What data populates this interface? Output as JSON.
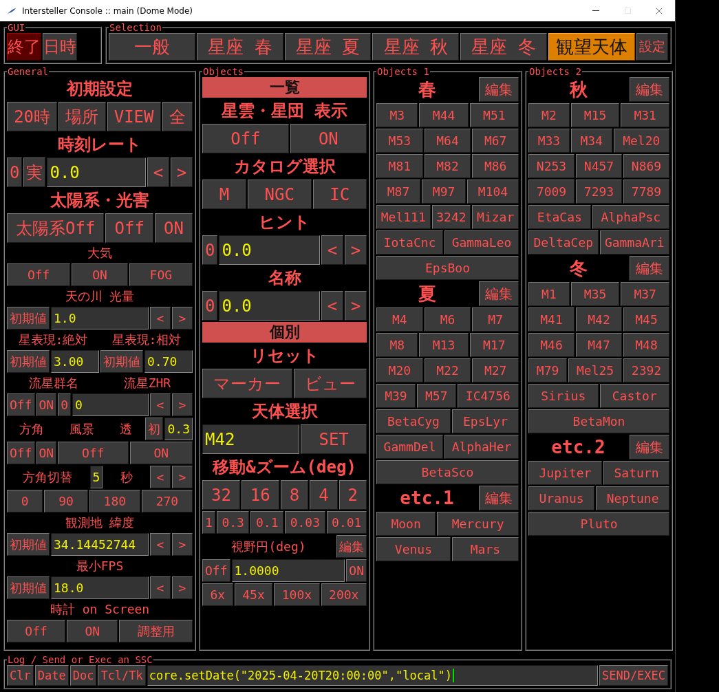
{
  "window": {
    "title": "Intersteller Console :: main (Dome Mode)"
  },
  "gui": {
    "title": "GUI",
    "buttons": [
      {
        "label": "終了",
        "selected": true
      },
      {
        "label": "日時",
        "selected": false
      }
    ]
  },
  "selection": {
    "title": "Selection",
    "tabs": [
      {
        "label": "一般",
        "selected": false,
        "kind": "tab"
      },
      {
        "label": "星座 春",
        "selected": false,
        "kind": "tab"
      },
      {
        "label": "星座 夏",
        "selected": false,
        "kind": "tab"
      },
      {
        "label": "星座 秋",
        "selected": false,
        "kind": "tab"
      },
      {
        "label": "星座 冬",
        "selected": false,
        "kind": "tab"
      },
      {
        "label": "観望天体",
        "selected": true,
        "kind": "tab"
      },
      {
        "label": "設定",
        "selected": false,
        "kind": "small"
      }
    ]
  },
  "panels": [
    {
      "title": "General",
      "rows": [
        {
          "kind": "heading",
          "items": [
            {
              "kind": "text",
              "label": "初期設定"
            }
          ]
        },
        {
          "kind": "large",
          "items": [
            {
              "kind": "button",
              "label": "20時"
            },
            {
              "kind": "button",
              "label": "場所"
            },
            {
              "kind": "button",
              "label": "VIEW"
            },
            {
              "kind": "button",
              "label": "全"
            }
          ]
        },
        {
          "kind": "heading",
          "items": [
            {
              "kind": "text",
              "label": "時刻レート"
            }
          ]
        },
        {
          "kind": "large",
          "items": [
            {
              "kind": "key",
              "label": "0"
            },
            {
              "kind": "key",
              "label": "実"
            },
            {
              "kind": "field",
              "label": "0.0"
            },
            {
              "kind": "step",
              "label": "<"
            },
            {
              "kind": "step",
              "label": ">"
            }
          ]
        },
        {
          "kind": "heading",
          "items": [
            {
              "kind": "text",
              "label": "太陽系・光害"
            }
          ]
        },
        {
          "kind": "large",
          "items": [
            {
              "kind": "button",
              "label": "太陽系Off"
            },
            {
              "kind": "button",
              "label": "Off"
            },
            {
              "kind": "button",
              "label": "ON"
            }
          ]
        },
        {
          "kind": "label",
          "items": [
            {
              "kind": "text",
              "label": "大気"
            }
          ]
        },
        {
          "kind": "small",
          "items": [
            {
              "kind": "button",
              "label": "Off"
            },
            {
              "kind": "button",
              "label": "ON"
            },
            {
              "kind": "button",
              "label": "FOG"
            }
          ]
        },
        {
          "kind": "label",
          "items": [
            {
              "kind": "text",
              "label": "天の川 光量"
            }
          ]
        },
        {
          "kind": "small",
          "items": [
            {
              "kind": "key",
              "label": "初期値"
            },
            {
              "kind": "field",
              "label": "1.0"
            },
            {
              "kind": "step",
              "label": "<"
            },
            {
              "kind": "step",
              "label": ">"
            }
          ]
        },
        {
          "kind": "label",
          "items": [
            {
              "kind": "text",
              "label": "星表現:絶対"
            },
            {
              "kind": "text",
              "label": "星表現:相対"
            }
          ]
        },
        {
          "kind": "small",
          "items": [
            {
              "kind": "key",
              "label": "初期値"
            },
            {
              "kind": "field",
              "label": "3.00"
            },
            {
              "kind": "key",
              "label": "初期値"
            },
            {
              "kind": "field",
              "label": "0.70"
            }
          ]
        },
        {
          "kind": "label",
          "items": [
            {
              "kind": "text",
              "label": "流星群名"
            },
            {
              "kind": "text",
              "label": "流星ZHR"
            }
          ]
        },
        {
          "kind": "small",
          "items": [
            {
              "kind": "key",
              "label": "Off"
            },
            {
              "kind": "key",
              "label": "ON"
            },
            {
              "kind": "key",
              "label": "0"
            },
            {
              "kind": "field",
              "label": "0"
            },
            {
              "kind": "step",
              "label": "<"
            },
            {
              "kind": "step",
              "label": ">"
            }
          ]
        },
        {
          "kind": "small",
          "items": [
            {
              "kind": "text",
              "label": "方角"
            },
            {
              "kind": "text",
              "label": "風景"
            },
            {
              "kind": "text",
              "label": "透"
            },
            {
              "kind": "key",
              "label": "初"
            },
            {
              "kind": "value",
              "label": "0.3"
            }
          ]
        },
        {
          "kind": "small",
          "items": [
            {
              "kind": "key",
              "label": "Off"
            },
            {
              "kind": "key",
              "label": "ON"
            },
            {
              "kind": "button",
              "label": "Off"
            },
            {
              "kind": "button",
              "label": "ON"
            }
          ]
        },
        {
          "kind": "small",
          "items": [
            {
              "kind": "text",
              "label": "方角切替"
            },
            {
              "kind": "value",
              "label": "5"
            },
            {
              "kind": "text",
              "label": "秒"
            },
            {
              "kind": "step",
              "label": "<"
            },
            {
              "kind": "step",
              "label": ">"
            }
          ]
        },
        {
          "kind": "small",
          "items": [
            {
              "kind": "button",
              "label": "0"
            },
            {
              "kind": "button",
              "label": "90"
            },
            {
              "kind": "button",
              "label": "180"
            },
            {
              "kind": "button",
              "label": "270"
            }
          ]
        },
        {
          "kind": "label",
          "items": [
            {
              "kind": "text",
              "label": "観測地 緯度"
            }
          ]
        },
        {
          "kind": "small",
          "items": [
            {
              "kind": "key",
              "label": "初期値"
            },
            {
              "kind": "field",
              "label": "34.14452744"
            },
            {
              "kind": "step",
              "label": "<"
            },
            {
              "kind": "step",
              "label": ">"
            }
          ]
        },
        {
          "kind": "label",
          "items": [
            {
              "kind": "text",
              "label": "最小FPS"
            }
          ]
        },
        {
          "kind": "small",
          "items": [
            {
              "kind": "key",
              "label": "初期値"
            },
            {
              "kind": "field",
              "label": "18.0"
            },
            {
              "kind": "step",
              "label": "<"
            },
            {
              "kind": "step",
              "label": ">"
            }
          ]
        },
        {
          "kind": "label",
          "items": [
            {
              "kind": "text",
              "label": "時計 on Screen"
            }
          ]
        },
        {
          "kind": "small",
          "items": [
            {
              "kind": "button",
              "label": "Off"
            },
            {
              "kind": "button",
              "label": "ON"
            },
            {
              "kind": "button",
              "label": "調整用"
            }
          ]
        }
      ]
    },
    {
      "title": "Objects",
      "rows": [
        {
          "kind": "banner",
          "items": [
            {
              "kind": "text",
              "label": "一覧"
            }
          ]
        },
        {
          "kind": "heading",
          "items": [
            {
              "kind": "text",
              "label": "星雲・星団 表示"
            }
          ]
        },
        {
          "kind": "large",
          "items": [
            {
              "kind": "button",
              "label": "Off"
            },
            {
              "kind": "button",
              "label": "ON"
            }
          ]
        },
        {
          "kind": "heading",
          "items": [
            {
              "kind": "text",
              "label": "カタログ選択"
            }
          ]
        },
        {
          "kind": "large",
          "items": [
            {
              "kind": "button",
              "label": "M"
            },
            {
              "kind": "button",
              "label": "NGC"
            },
            {
              "kind": "button",
              "label": "IC"
            }
          ]
        },
        {
          "kind": "heading",
          "items": [
            {
              "kind": "text",
              "label": "ヒント"
            }
          ]
        },
        {
          "kind": "large",
          "items": [
            {
              "kind": "key",
              "label": "0"
            },
            {
              "kind": "field",
              "label": "0.0"
            },
            {
              "kind": "step",
              "label": "<"
            },
            {
              "kind": "step",
              "label": ">"
            }
          ]
        },
        {
          "kind": "heading",
          "items": [
            {
              "kind": "text",
              "label": "名称"
            }
          ]
        },
        {
          "kind": "large",
          "items": [
            {
              "kind": "key",
              "label": "0"
            },
            {
              "kind": "field",
              "label": "0.0"
            },
            {
              "kind": "step",
              "label": "<"
            },
            {
              "kind": "step",
              "label": ">"
            }
          ]
        },
        {
          "kind": "banner",
          "items": [
            {
              "kind": "text",
              "label": "個別"
            }
          ]
        },
        {
          "kind": "heading",
          "items": [
            {
              "kind": "text",
              "label": "リセット"
            }
          ]
        },
        {
          "kind": "large",
          "items": [
            {
              "kind": "button",
              "label": "マーカー"
            },
            {
              "kind": "button",
              "label": "ビュー"
            }
          ]
        },
        {
          "kind": "heading",
          "items": [
            {
              "kind": "text",
              "label": "天体選択"
            }
          ]
        },
        {
          "kind": "large",
          "items": [
            {
              "kind": "field",
              "label": "M42"
            },
            {
              "kind": "button",
              "label": "SET"
            }
          ]
        },
        {
          "kind": "heading",
          "items": [
            {
              "kind": "text",
              "label": "移動&ズーム(deg)"
            }
          ]
        },
        {
          "kind": "large",
          "items": [
            {
              "kind": "button",
              "label": "32"
            },
            {
              "kind": "button",
              "label": "16"
            },
            {
              "kind": "button",
              "label": "8"
            },
            {
              "kind": "button",
              "label": "4"
            },
            {
              "kind": "button",
              "label": "2"
            }
          ]
        },
        {
          "kind": "small",
          "items": [
            {
              "kind": "key",
              "label": "1"
            },
            {
              "kind": "button",
              "label": "0.3"
            },
            {
              "kind": "button",
              "label": "0.1"
            },
            {
              "kind": "button",
              "label": "0.03"
            },
            {
              "kind": "button",
              "label": "0.01"
            }
          ]
        },
        {
          "kind": "small",
          "items": [
            {
              "kind": "text",
              "label": "視野円(deg)"
            },
            {
              "kind": "key",
              "label": "編集"
            }
          ]
        },
        {
          "kind": "small",
          "items": [
            {
              "kind": "key",
              "label": "Off"
            },
            {
              "kind": "field",
              "label": "1.0000"
            },
            {
              "kind": "key",
              "label": "ON"
            }
          ]
        },
        {
          "kind": "small",
          "items": [
            {
              "kind": "button",
              "label": "6x"
            },
            {
              "kind": "button",
              "label": "45x"
            },
            {
              "kind": "button",
              "label": "100x"
            },
            {
              "kind": "button",
              "label": "200x"
            }
          ]
        }
      ]
    },
    {
      "title": "Objects 1",
      "rows": [
        {
          "kind": "section",
          "items": [
            {
              "kind": "text",
              "label": "春"
            },
            {
              "kind": "key",
              "label": "編集"
            }
          ]
        },
        {
          "kind": "list",
          "items": [
            {
              "kind": "button",
              "label": "M3"
            },
            {
              "kind": "button",
              "label": "M44"
            },
            {
              "kind": "button",
              "label": "M51"
            }
          ]
        },
        {
          "kind": "list",
          "items": [
            {
              "kind": "button",
              "label": "M53"
            },
            {
              "kind": "button",
              "label": "M64"
            },
            {
              "kind": "button",
              "label": "M67"
            }
          ]
        },
        {
          "kind": "list",
          "items": [
            {
              "kind": "button",
              "label": "M81"
            },
            {
              "kind": "button",
              "label": "M82"
            },
            {
              "kind": "button",
              "label": "M86"
            }
          ]
        },
        {
          "kind": "list",
          "items": [
            {
              "kind": "button",
              "label": "M87"
            },
            {
              "kind": "button",
              "label": "M97"
            },
            {
              "kind": "button",
              "label": "M104"
            }
          ]
        },
        {
          "kind": "list",
          "items": [
            {
              "kind": "button",
              "label": "Mel111"
            },
            {
              "kind": "button",
              "label": "3242"
            },
            {
              "kind": "button",
              "label": "Mizar"
            }
          ]
        },
        {
          "kind": "list",
          "items": [
            {
              "kind": "button",
              "label": "IotaCnc"
            },
            {
              "kind": "button",
              "label": "GammaLeo"
            }
          ]
        },
        {
          "kind": "list",
          "items": [
            {
              "kind": "button",
              "label": "EpsBoo"
            }
          ]
        },
        {
          "kind": "section",
          "items": [
            {
              "kind": "text",
              "label": "夏"
            },
            {
              "kind": "key",
              "label": "編集"
            }
          ]
        },
        {
          "kind": "list",
          "items": [
            {
              "kind": "button",
              "label": "M4"
            },
            {
              "kind": "button",
              "label": "M6"
            },
            {
              "kind": "button",
              "label": "M7"
            }
          ]
        },
        {
          "kind": "list",
          "items": [
            {
              "kind": "button",
              "label": "M8"
            },
            {
              "kind": "button",
              "label": "M13"
            },
            {
              "kind": "button",
              "label": "M17"
            }
          ]
        },
        {
          "kind": "list",
          "items": [
            {
              "kind": "button",
              "label": "M20"
            },
            {
              "kind": "button",
              "label": "M22"
            },
            {
              "kind": "button",
              "label": "M27"
            }
          ]
        },
        {
          "kind": "list",
          "items": [
            {
              "kind": "button",
              "label": "M39"
            },
            {
              "kind": "button",
              "label": "M57"
            },
            {
              "kind": "button",
              "label": "IC4756"
            }
          ]
        },
        {
          "kind": "list",
          "items": [
            {
              "kind": "button",
              "label": "BetaCyg"
            },
            {
              "kind": "button",
              "label": "EpsLyr"
            }
          ]
        },
        {
          "kind": "list",
          "items": [
            {
              "kind": "button",
              "label": "GammDel"
            },
            {
              "kind": "button",
              "label": "AlphaHer"
            }
          ]
        },
        {
          "kind": "list",
          "items": [
            {
              "kind": "button",
              "label": "BetaSco"
            }
          ]
        },
        {
          "kind": "section",
          "items": [
            {
              "kind": "text",
              "label": "etc.1"
            },
            {
              "kind": "key",
              "label": "編集"
            }
          ]
        },
        {
          "kind": "list",
          "items": [
            {
              "kind": "button",
              "label": "Moon"
            },
            {
              "kind": "button",
              "label": "Mercury"
            }
          ]
        },
        {
          "kind": "list",
          "items": [
            {
              "kind": "button",
              "label": "Venus"
            },
            {
              "kind": "button",
              "label": "Mars"
            }
          ]
        }
      ]
    },
    {
      "title": "Objects 2",
      "rows": [
        {
          "kind": "section",
          "items": [
            {
              "kind": "text",
              "label": "秋"
            },
            {
              "kind": "key",
              "label": "編集"
            }
          ]
        },
        {
          "kind": "list",
          "items": [
            {
              "kind": "button",
              "label": "M2"
            },
            {
              "kind": "button",
              "label": "M15"
            },
            {
              "kind": "button",
              "label": "M31"
            }
          ]
        },
        {
          "kind": "list",
          "items": [
            {
              "kind": "button",
              "label": "M33"
            },
            {
              "kind": "button",
              "label": "M34"
            },
            {
              "kind": "button",
              "label": "Mel20"
            }
          ]
        },
        {
          "kind": "list",
          "items": [
            {
              "kind": "button",
              "label": "N253"
            },
            {
              "kind": "button",
              "label": "N457"
            },
            {
              "kind": "button",
              "label": "N869"
            }
          ]
        },
        {
          "kind": "list",
          "items": [
            {
              "kind": "button",
              "label": "7009"
            },
            {
              "kind": "button",
              "label": "7293"
            },
            {
              "kind": "button",
              "label": "7789"
            }
          ]
        },
        {
          "kind": "list",
          "items": [
            {
              "kind": "button",
              "label": "EtaCas"
            },
            {
              "kind": "button",
              "label": "AlphaPsc"
            }
          ]
        },
        {
          "kind": "list",
          "items": [
            {
              "kind": "button",
              "label": "DeltaCep"
            },
            {
              "kind": "button",
              "label": "GammaAri"
            }
          ]
        },
        {
          "kind": "section",
          "items": [
            {
              "kind": "text",
              "label": "冬"
            },
            {
              "kind": "key",
              "label": "編集"
            }
          ]
        },
        {
          "kind": "list",
          "items": [
            {
              "kind": "button",
              "label": "M1"
            },
            {
              "kind": "button",
              "label": "M35"
            },
            {
              "kind": "button",
              "label": "M37"
            }
          ]
        },
        {
          "kind": "list",
          "items": [
            {
              "kind": "button",
              "label": "M41"
            },
            {
              "kind": "button",
              "label": "M42"
            },
            {
              "kind": "button",
              "label": "M45"
            }
          ]
        },
        {
          "kind": "list",
          "items": [
            {
              "kind": "button",
              "label": "M46"
            },
            {
              "kind": "button",
              "label": "M47"
            },
            {
              "kind": "button",
              "label": "M48"
            }
          ]
        },
        {
          "kind": "list",
          "items": [
            {
              "kind": "button",
              "label": "M79"
            },
            {
              "kind": "button",
              "label": "Mel25"
            },
            {
              "kind": "button",
              "label": "2392"
            }
          ]
        },
        {
          "kind": "list",
          "items": [
            {
              "kind": "button",
              "label": "Sirius"
            },
            {
              "kind": "button",
              "label": "Castor"
            }
          ]
        },
        {
          "kind": "list",
          "items": [
            {
              "kind": "button",
              "label": "BetaMon"
            }
          ]
        },
        {
          "kind": "section",
          "items": [
            {
              "kind": "text",
              "label": "etc.2"
            },
            {
              "kind": "key",
              "label": "編集"
            }
          ]
        },
        {
          "kind": "list",
          "items": [
            {
              "kind": "button",
              "label": "Jupiter"
            },
            {
              "kind": "button",
              "label": "Saturn"
            }
          ]
        },
        {
          "kind": "list",
          "items": [
            {
              "kind": "button",
              "label": "Uranus"
            },
            {
              "kind": "button",
              "label": "Neptune"
            }
          ]
        },
        {
          "kind": "list",
          "items": [
            {
              "kind": "button",
              "label": "Pluto"
            }
          ]
        }
      ]
    }
  ],
  "log": {
    "title": "Log / Send or Exec an SSC",
    "buttons": [
      "Clr",
      "Date",
      "Doc",
      "Tcl/Tk"
    ],
    "command": "core.setDate(\"2025-04-20T20:00:00\",\"local\")",
    "submit": "SEND/EXEC"
  }
}
